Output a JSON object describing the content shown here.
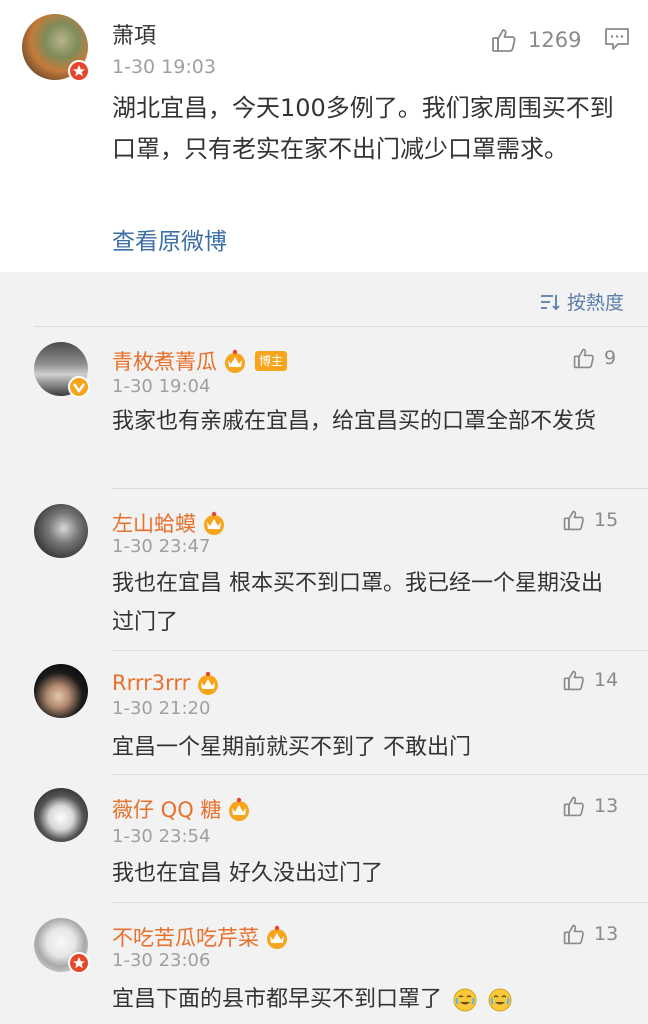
{
  "post": {
    "author": "萧項",
    "time": "1-30 19:03",
    "likes": "1269",
    "content": "湖北宜昌，今天100多例了。我们家周围买不到口罩，只有老实在家不出门减少口罩需求。",
    "view_original": "查看原微博"
  },
  "sort": {
    "label": "按熱度",
    "icon": "sort-icon"
  },
  "comments": [
    {
      "name": "青枚煮菁瓜",
      "badge": "博主",
      "time": "1-30 19:04",
      "likes": "9",
      "text": "我家也有亲戚在宜昌，给宜昌买的口罩全部不发货"
    },
    {
      "name": "左山蛤蟆",
      "time": "1-30 23:47",
      "likes": "15",
      "text": "我也在宜昌 根本买不到口罩。我已经一个星期没出过门了"
    },
    {
      "name": "Rrrr3rrr",
      "time": "1-30 21:20",
      "likes": "14",
      "text": "宜昌一个星期前就买不到了 不敢出门"
    },
    {
      "name": "薇仔 QQ 糖",
      "time": "1-30 23:54",
      "likes": "13",
      "text": "我也在宜昌 好久没出过门了"
    },
    {
      "name": "不吃苦瓜吃芹菜",
      "time": "1-30 23:06",
      "likes": "13",
      "text": "宜昌下面的县市都早买不到口罩了"
    }
  ],
  "colors": {
    "username": "#e8702b",
    "link": "#3c6fa8",
    "meta": "#a0a0a0",
    "badge_red": "#e8462c",
    "badge_orange": "#f7a51c"
  }
}
